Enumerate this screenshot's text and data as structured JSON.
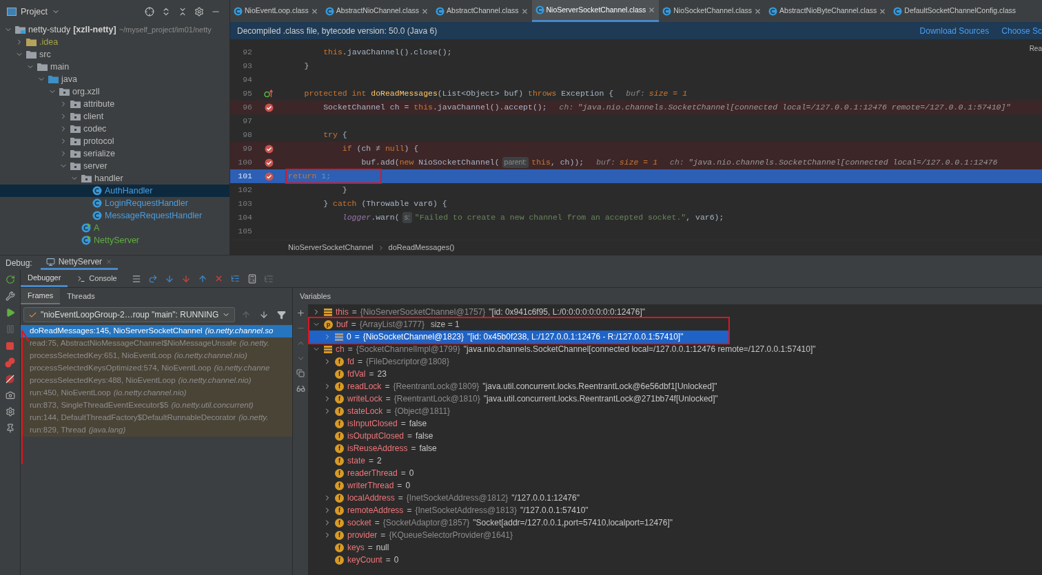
{
  "tree": {
    "header": "Project",
    "items": [
      {
        "kind": "module",
        "name": "netty-study",
        "module": "[xzll-netty]",
        "path": "~/myself_project/im01/netty",
        "expanded": true,
        "selected": false,
        "children": [
          {
            "kind": "excluded-folder",
            "name": ".idea",
            "expanded": false,
            "selected": false
          },
          {
            "kind": "folder",
            "name": "src",
            "expanded": true,
            "selected": false,
            "children": [
              {
                "kind": "folder",
                "name": "main",
                "expanded": true,
                "selected": false,
                "children": [
                  {
                    "kind": "source-folder",
                    "name": "java",
                    "expanded": true,
                    "selected": false,
                    "children": [
                      {
                        "kind": "package",
                        "name": "org.xzll",
                        "expanded": true,
                        "selected": false,
                        "children": [
                          {
                            "kind": "package",
                            "name": "attribute",
                            "expanded": false,
                            "selected": false
                          },
                          {
                            "kind": "package",
                            "name": "client",
                            "expanded": false,
                            "selected": false
                          },
                          {
                            "kind": "package",
                            "name": "codec",
                            "expanded": false,
                            "selected": false
                          },
                          {
                            "kind": "package",
                            "name": "protocol",
                            "expanded": false,
                            "selected": false
                          },
                          {
                            "kind": "package",
                            "name": "serialize",
                            "expanded": false,
                            "selected": false
                          },
                          {
                            "kind": "package",
                            "name": "server",
                            "expanded": true,
                            "selected": false,
                            "children": [
                              {
                                "kind": "package",
                                "name": "handler",
                                "expanded": true,
                                "selected": false,
                                "children": [
                                  {
                                    "kind": "class",
                                    "name": "AuthHandler",
                                    "selected": true
                                  },
                                  {
                                    "kind": "class",
                                    "name": "LoginRequestHandler",
                                    "selected": false
                                  },
                                  {
                                    "kind": "class",
                                    "name": "MessageRequestHandler",
                                    "selected": false
                                  }
                                ]
                              },
                              {
                                "kind": "main-class",
                                "name": "A",
                                "selected": false
                              },
                              {
                                "kind": "main-class",
                                "name": "NettyServer",
                                "selected": false
                              }
                            ]
                          }
                        ]
                      }
                    ]
                  }
                ]
              }
            ]
          }
        ]
      }
    ]
  },
  "editor": {
    "tabs": [
      {
        "label": "NioEventLoop.class",
        "selected": false,
        "closable": true
      },
      {
        "label": "AbstractNioChannel.class",
        "selected": false,
        "closable": true
      },
      {
        "label": "AbstractChannel.class",
        "selected": false,
        "closable": true
      },
      {
        "label": "NioServerSocketChannel.class",
        "selected": true,
        "closable": true
      },
      {
        "label": "NioSocketChannel.class",
        "selected": false,
        "closable": true
      },
      {
        "label": "AbstractNioByteChannel.class",
        "selected": false,
        "closable": true
      },
      {
        "label": "DefaultSocketChannelConfig.class",
        "selected": false,
        "closable": false
      }
    ],
    "banner": {
      "text": "Decompiled .class file, bytecode version: 50.0 (Java 6)",
      "links": [
        "Download Sources",
        "Choose Sc"
      ]
    },
    "side_label": "Rea",
    "lines": [
      {
        "num": "92",
        "breakpoint": false,
        "current": false,
        "override": false,
        "boxed": false,
        "tokens": [
          {
            "kind": "kw",
            "text": "        this"
          },
          {
            "kind": "plain",
            "text": ".javaChannel().close();"
          }
        ]
      },
      {
        "num": "93",
        "breakpoint": false,
        "current": false,
        "override": false,
        "boxed": false,
        "tokens": [
          {
            "kind": "plain",
            "text": "    }"
          }
        ]
      },
      {
        "num": "94",
        "breakpoint": false,
        "current": false,
        "override": false,
        "boxed": false
      },
      {
        "num": "95",
        "breakpoint": false,
        "current": false,
        "override": true,
        "boxed": false,
        "tokens": [
          {
            "kind": "kw",
            "text": "    protected int "
          },
          {
            "kind": "fn",
            "text": "doReadMessages"
          },
          {
            "kind": "plain",
            "text": "(List<Object> buf) "
          },
          {
            "kind": "kw",
            "text": "throws"
          },
          {
            "kind": "plain",
            "text": " Exception {"
          },
          {
            "kind": "hint",
            "text": "buf:"
          },
          {
            "kind": "hintv",
            "text": "size = 1"
          }
        ]
      },
      {
        "num": "96",
        "breakpoint": true,
        "current": false,
        "override": false,
        "boxed": false,
        "tokens": [
          {
            "kind": "plain",
            "text": "        SocketChannel ch = "
          },
          {
            "kind": "kw",
            "text": "this"
          },
          {
            "kind": "plain",
            "text": ".javaChannel().accept();"
          },
          {
            "kind": "hint",
            "text": "ch:"
          },
          {
            "kind": "hints",
            "text": "\"java.nio.channels.SocketChannel[connected local=/127.0.0.1:12476 remote=/127.0.0.1:57410]\""
          }
        ]
      },
      {
        "num": "97",
        "breakpoint": false,
        "current": false,
        "override": false,
        "boxed": false
      },
      {
        "num": "98",
        "breakpoint": false,
        "current": false,
        "override": false,
        "boxed": false,
        "tokens": [
          {
            "kind": "kw",
            "text": "        try"
          },
          {
            "kind": "plain",
            "text": " {"
          }
        ]
      },
      {
        "num": "99",
        "breakpoint": true,
        "current": false,
        "override": false,
        "boxed": false,
        "tokens": [
          {
            "kind": "kw",
            "text": "            if"
          },
          {
            "kind": "plain",
            "text": " (ch ≠ "
          },
          {
            "kind": "kw",
            "text": "null"
          },
          {
            "kind": "plain",
            "text": ") {"
          }
        ]
      },
      {
        "num": "100",
        "breakpoint": true,
        "current": false,
        "override": false,
        "boxed": false,
        "tokens": [
          {
            "kind": "plain",
            "text": "                buf.add("
          },
          {
            "kind": "kw",
            "text": "new"
          },
          {
            "kind": "plain",
            "text": " NioSocketChannel("
          },
          {
            "kind": "param",
            "text": "parent:"
          },
          {
            "kind": "kw",
            "text": "this"
          },
          {
            "kind": "plain",
            "text": ", ch));"
          },
          {
            "kind": "hint",
            "text": "buf:"
          },
          {
            "kind": "hintv",
            "text": "size = 1"
          },
          {
            "kind": "hint",
            "text": "ch:"
          },
          {
            "kind": "hints",
            "text": "\"java.nio.channels.SocketChannel[connected local=/127.0.0.1:12476"
          }
        ]
      },
      {
        "num": "101",
        "breakpoint": true,
        "current": true,
        "override": false,
        "boxed": true,
        "tokens": [
          {
            "kind": "kw",
            "text": "return"
          },
          {
            "kind": "num",
            "text": " 1;"
          }
        ]
      },
      {
        "num": "102",
        "breakpoint": false,
        "current": false,
        "override": false,
        "boxed": false,
        "tokens": [
          {
            "kind": "plain",
            "text": "            }"
          }
        ]
      },
      {
        "num": "103",
        "breakpoint": false,
        "current": false,
        "override": false,
        "boxed": false,
        "tokens": [
          {
            "kind": "plain",
            "text": "        } "
          },
          {
            "kind": "kw",
            "text": "catch"
          },
          {
            "kind": "plain",
            "text": " (Throwable var6) {"
          }
        ]
      },
      {
        "num": "104",
        "breakpoint": false,
        "current": false,
        "override": false,
        "boxed": false,
        "tokens": [
          {
            "kind": "field",
            "text": "            logger"
          },
          {
            "kind": "plain",
            "text": ".warn("
          },
          {
            "kind": "param",
            "text": "s:"
          },
          {
            "kind": "str",
            "text": "\"Failed to create a new channel from an accepted socket.\""
          },
          {
            "kind": "plain",
            "text": ", var6);"
          }
        ]
      },
      {
        "num": "105",
        "breakpoint": false,
        "current": false,
        "override": false,
        "boxed": false
      }
    ],
    "breadcrumbs": [
      "NioServerSocketChannel",
      "doReadMessages()"
    ]
  },
  "debug": {
    "label": "Debug:",
    "session": "NettyServer",
    "tabs": [
      {
        "label": "Debugger",
        "selected": true
      },
      {
        "label": "Console",
        "selected": false
      }
    ],
    "frame_tabs": [
      {
        "label": "Frames",
        "selected": true
      },
      {
        "label": "Threads",
        "selected": false
      }
    ],
    "thread": "\"nioEventLoopGroup-2…roup \"main\": RUNNING",
    "frames": [
      {
        "method": "doReadMessages:145, NioServerSocketChannel",
        "package": "(io.netty.channel.so",
        "selected": true
      },
      {
        "method": "read:75, AbstractNioMessageChannel$NioMessageUnsafe",
        "package": "(io.netty.",
        "selected": false
      },
      {
        "method": "processSelectedKey:651, NioEventLoop",
        "package": "(io.netty.channel.nio)",
        "selected": false
      },
      {
        "method": "processSelectedKeysOptimized:574, NioEventLoop",
        "package": "(io.netty.channe",
        "selected": false
      },
      {
        "method": "processSelectedKeys:488, NioEventLoop",
        "package": "(io.netty.channel.nio)",
        "selected": false
      },
      {
        "method": "run:450, NioEventLoop",
        "package": "(io.netty.channel.nio)",
        "selected": false
      },
      {
        "method": "run:873, SingleThreadEventExecutor$5",
        "package": "(io.netty.util.concurrent)",
        "selected": false
      },
      {
        "method": "run:144, DefaultThreadFactory$DefaultRunnableDecorator",
        "package": "(io.netty.",
        "selected": false
      },
      {
        "method": "run:829, Thread",
        "package": "(java.lang)",
        "selected": false
      }
    ],
    "variables": {
      "header": "Variables",
      "rows": [
        {
          "kind": "local",
          "name": "this",
          "op": "=",
          "type": "{NioServerSocketChannel@1757}",
          "value": "\"[id: 0x941c6f95, L:/0:0:0:0:0:0:0:0:12476]\"",
          "expanded": false,
          "selected": false,
          "boxed": false
        },
        {
          "kind": "param",
          "icon": "p",
          "name": "buf",
          "op": "=",
          "type": "{ArrayList@1777}",
          "extra": "size = 1",
          "expanded": true,
          "selected": false,
          "boxed": true,
          "children": [
            {
              "kind": "element",
              "name": "0",
              "op": "=",
              "type": "{NioSocketChannel@1823}",
              "value": "\"[id: 0x45b0f238, L:/127.0.0.1:12476 - R:/127.0.0.1:57410]\"",
              "expanded": false,
              "selected": true,
              "boxed": false
            }
          ]
        },
        {
          "kind": "local",
          "name": "ch",
          "op": "=",
          "type": "{SocketChannelImpl@1799}",
          "value": "\"java.nio.channels.SocketChannel[connected local=/127.0.0.1:12476 remote=/127.0.0.1:57410]\"",
          "expanded": true,
          "selected": false,
          "boxed": false,
          "children": [
            {
              "kind": "field",
              "icon": "f",
              "name": "fd",
              "op": "=",
              "type": "{FileDescriptor@1808}",
              "expanded": false,
              "selected": false,
              "boxed": false
            },
            {
              "kind": "field",
              "icon": "f",
              "name": "fdVal",
              "op": "=",
              "value": "23",
              "selected": false,
              "boxed": false
            },
            {
              "kind": "field",
              "icon": "f",
              "name": "readLock",
              "op": "=",
              "type": "{ReentrantLock@1809}",
              "value": "\"java.util.concurrent.locks.ReentrantLock@6e56dbf1[Unlocked]\"",
              "expanded": false,
              "selected": false,
              "boxed": false
            },
            {
              "kind": "field",
              "icon": "f",
              "name": "writeLock",
              "op": "=",
              "type": "{ReentrantLock@1810}",
              "value": "\"java.util.concurrent.locks.ReentrantLock@271bb74f[Unlocked]\"",
              "expanded": false,
              "selected": false,
              "boxed": false
            },
            {
              "kind": "field",
              "icon": "f",
              "name": "stateLock",
              "op": "=",
              "type": "{Object@1811}",
              "expanded": false,
              "selected": false,
              "boxed": false
            },
            {
              "kind": "field",
              "icon": "f",
              "name": "isInputClosed",
              "op": "=",
              "value": "false",
              "selected": false,
              "boxed": false
            },
            {
              "kind": "field",
              "icon": "f",
              "name": "isOutputClosed",
              "op": "=",
              "value": "false",
              "selected": false,
              "boxed": false
            },
            {
              "kind": "field",
              "icon": "f",
              "name": "isReuseAddress",
              "op": "=",
              "value": "false",
              "selected": false,
              "boxed": false
            },
            {
              "kind": "field",
              "icon": "f",
              "name": "state",
              "op": "=",
              "value": "2",
              "selected": false,
              "boxed": false
            },
            {
              "kind": "field",
              "icon": "f",
              "name": "readerThread",
              "op": "=",
              "value": "0",
              "selected": false,
              "boxed": false
            },
            {
              "kind": "field",
              "icon": "f",
              "name": "writerThread",
              "op": "=",
              "value": "0",
              "selected": false,
              "boxed": false
            },
            {
              "kind": "field",
              "icon": "f",
              "name": "localAddress",
              "op": "=",
              "type": "{InetSocketAddress@1812}",
              "value": "\"/127.0.0.1:12476\"",
              "expanded": false,
              "selected": false,
              "boxed": false
            },
            {
              "kind": "field",
              "icon": "f",
              "name": "remoteAddress",
              "op": "=",
              "type": "{InetSocketAddress@1813}",
              "value": "\"/127.0.0.1:57410\"",
              "expanded": false,
              "selected": false,
              "boxed": false
            },
            {
              "kind": "field",
              "icon": "f",
              "name": "socket",
              "op": "=",
              "type": "{SocketAdaptor@1857}",
              "value": "\"Socket[addr=/127.0.0.1,port=57410,localport=12476]\"",
              "expanded": false,
              "selected": false,
              "boxed": false
            },
            {
              "kind": "field",
              "icon": "f",
              "name": "provider",
              "op": "=",
              "type": "{KQueueSelectorProvider@1641}",
              "expanded": false,
              "selected": false,
              "boxed": false
            },
            {
              "kind": "field",
              "icon": "f",
              "name": "keys",
              "op": "=",
              "value": "null",
              "selected": false,
              "boxed": false
            },
            {
              "kind": "field",
              "icon": "f",
              "name": "keyCount",
              "op": "=",
              "value": "0",
              "selected": false,
              "boxed": false
            }
          ]
        }
      ]
    }
  }
}
